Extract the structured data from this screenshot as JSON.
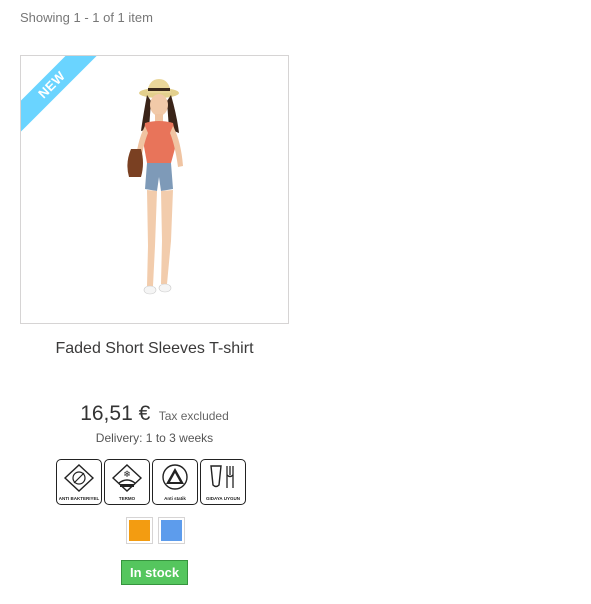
{
  "listing": {
    "showing_text": "Showing 1 - 1 of 1 item"
  },
  "product": {
    "new_label": "NEW",
    "name": "Faded Short Sleeves T-shirt",
    "price": "16,51 €",
    "tax_label": "Tax excluded",
    "delivery": "Delivery: 1 to 3 weeks",
    "badges": [
      {
        "label": "ANTI BAKTERIYEL",
        "icon": "anti-bacterial-icon"
      },
      {
        "label": "TERMO",
        "icon": "thermo-icon"
      },
      {
        "label": "Anti statik",
        "icon": "anti-static-icon"
      },
      {
        "label": "GIDAYA UYGUN",
        "icon": "food-safe-icon"
      }
    ],
    "colors": [
      {
        "name": "Orange",
        "hex": "#f39c11"
      },
      {
        "name": "Blue",
        "hex": "#5d9cec"
      }
    ],
    "availability": "In stock",
    "availability_color": "#55c65e"
  }
}
